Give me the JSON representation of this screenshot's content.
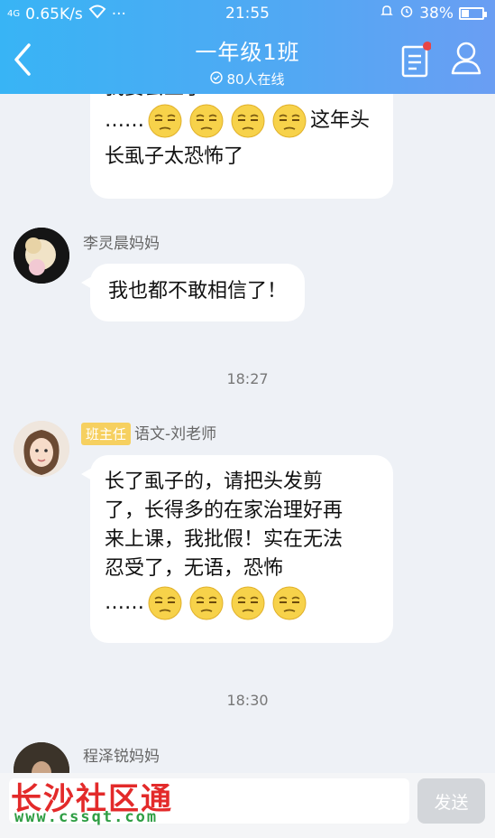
{
  "status_bar": {
    "signal": "4G",
    "speed": "0.65K/s",
    "dots": "···",
    "time": "21:55",
    "battery": "38%",
    "battery_level": 0.38
  },
  "header": {
    "title": "一年级1班",
    "online": "80人在线",
    "has_notification": true
  },
  "messages": {
    "m0": {
      "text_top": "我要会上了",
      "text_dots": "……",
      "text_after": "这年头",
      "text_line2": "长虱子太恐怖了"
    },
    "m1": {
      "sender": "李灵晨妈妈",
      "text": "我也都不敢相信了！"
    },
    "time1": "18:27",
    "m2": {
      "badge": "班主任",
      "sender": "语文-刘老师",
      "lines": [
        "长了虱子的，请把头发剪",
        "了，长得多的在家治理好再",
        "来上课，我批假！实在无法",
        "忍受了，无语，恐怖"
      ],
      "text_dots": "……"
    },
    "time2": "18:30",
    "m3": {
      "sender": "程泽锐妈妈"
    }
  },
  "input_bar": {
    "send_label": "发送"
  },
  "watermark": {
    "title": "长沙社区通",
    "url": "www.cssqt.com"
  },
  "colors": {
    "header_start": "#38b4f5",
    "header_end": "#6a9ef3",
    "badge": "#f6d060",
    "watermark_red": "#e32a2a",
    "watermark_green": "#2f9e44"
  }
}
